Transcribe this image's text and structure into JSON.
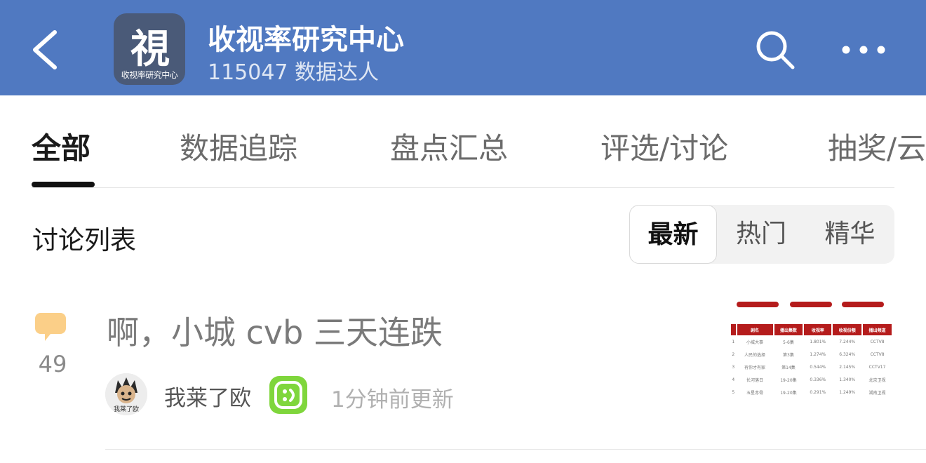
{
  "header": {
    "logo_char": "視",
    "logo_subtitle": "收视率研究中心",
    "title": "收视率研究中心",
    "subtitle": "115047 数据达人",
    "bg_color": "#5079c1"
  },
  "icons": {
    "back": "chevron-left",
    "search": "search",
    "more": "more-horizontal",
    "comment": "speech-bubble"
  },
  "tabs": [
    {
      "label": "全部",
      "active": true
    },
    {
      "label": "数据追踪",
      "active": false
    },
    {
      "label": "盘点汇总",
      "active": false
    },
    {
      "label": "评选/讨论",
      "active": false
    },
    {
      "label": "抽奖/云",
      "active": false
    }
  ],
  "list": {
    "title": "讨论列表",
    "sort_options": [
      {
        "label": "最新",
        "active": true
      },
      {
        "label": "热门",
        "active": false
      },
      {
        "label": "精华",
        "active": false
      }
    ]
  },
  "posts": [
    {
      "comment_count": "49",
      "title": "啊，小城 cvb 三天连跌",
      "author": "我莱了欧",
      "avatar_text": "我莱了欧",
      "updated": "1分钟前更新",
      "thumbnail": {
        "headers": [
          "剧名",
          "播出集数",
          "收视率",
          "收视份额",
          "播出频道"
        ],
        "rows": [
          [
            "1",
            "小城大事",
            "5-6集",
            "1.801%",
            "7.244%",
            "CCTV8"
          ],
          [
            "2",
            "人民的选择",
            "第3集",
            "1.274%",
            "6.324%",
            "CCTV8"
          ],
          [
            "3",
            "有你才有家",
            "第14集",
            "0.544%",
            "2.145%",
            "CCTV17"
          ],
          [
            "4",
            "长河落日",
            "19-20集",
            "0.336%",
            "1.340%",
            "北京卫视"
          ],
          [
            "5",
            "五星赤骨",
            "19-20集",
            "0.291%",
            "1.249%",
            "湖南卫视"
          ]
        ]
      }
    }
  ]
}
